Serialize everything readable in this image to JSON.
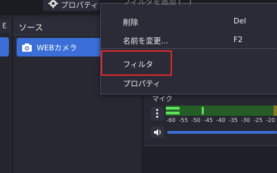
{
  "toolbar": {
    "properties_label": "プロパティ"
  },
  "scenes": {
    "header_glyph": "Ɛ"
  },
  "sources": {
    "title": "ソース",
    "items": [
      {
        "label": "WEBカメラ",
        "icon": "camera-icon"
      }
    ]
  },
  "mixer": {
    "channel_label": "マイク",
    "scale": [
      "-60",
      "-55",
      "-50",
      "-45",
      "-40",
      "-35",
      "-30",
      "-25",
      "-20"
    ]
  },
  "context_menu": {
    "faded_top_text": "フィルタを追加 (...)",
    "items": [
      {
        "label": "削除",
        "shortcut": "Del"
      },
      {
        "label": "名前を変更...",
        "shortcut": "F2"
      },
      {
        "label": "フィルタ",
        "shortcut": ""
      },
      {
        "label": "プロパティ",
        "shortcut": ""
      }
    ]
  },
  "colors": {
    "accent": "#3b6ed6",
    "highlight_border": "#e0282b",
    "meter_green": "#5ee25e"
  }
}
